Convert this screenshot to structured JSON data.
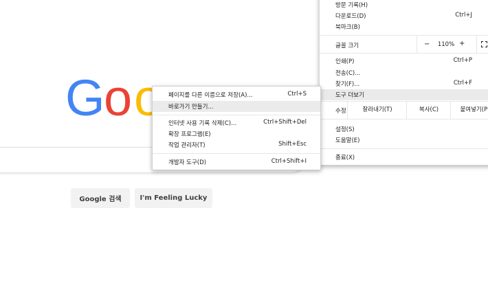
{
  "google": {
    "logo_letters": [
      {
        "ch": "G",
        "color": "#4285F4"
      },
      {
        "ch": "o",
        "color": "#EA4335"
      },
      {
        "ch": "o",
        "color": "#FBBC05"
      }
    ],
    "search_value": "",
    "search_button": "Google 검색",
    "lucky_button": "I'm Feeling Lucky"
  },
  "main_menu": {
    "history": {
      "label": "방문 기록(H)",
      "shortcut": ""
    },
    "downloads": {
      "label": "다운로드(D)",
      "shortcut": "Ctrl+J"
    },
    "bookmarks": {
      "label": "북마크(B)",
      "shortcut": ""
    },
    "zoom": {
      "label": "글꼴 크기",
      "minus": "−",
      "value": "110%",
      "plus": "+"
    },
    "print": {
      "label": "인쇄(P)",
      "shortcut": "Ctrl+P"
    },
    "cast": {
      "label": "전송(C)...",
      "shortcut": ""
    },
    "find": {
      "label": "찾기(F)...",
      "shortcut": "Ctrl+F"
    },
    "more_tools": {
      "label": "도구 더보기",
      "shortcut": ""
    },
    "edit": {
      "label": "수정",
      "cut": "잘라내기(T)",
      "copy": "복사(C)",
      "paste": "붙여넣기(P)"
    },
    "settings": {
      "label": "설정(S)"
    },
    "help": {
      "label": "도움말(E)"
    },
    "exit": {
      "label": "종료(X)"
    }
  },
  "sub_menu": {
    "save_page": {
      "label": "페이지를 다른 이름으로 저장(A)...",
      "shortcut": "Ctrl+S"
    },
    "create_shortcut": {
      "label": "바로가기 만들기...",
      "shortcut": ""
    },
    "clear_data": {
      "label": "인터넷 사용 기록 삭제(C)...",
      "shortcut": "Ctrl+Shift+Del"
    },
    "extensions": {
      "label": "확장 프로그램(E)",
      "shortcut": ""
    },
    "task_manager": {
      "label": "작업 관리자(T)",
      "shortcut": "Shift+Esc"
    },
    "dev_tools": {
      "label": "개발자 도구(D)",
      "shortcut": "Ctrl+Shift+I"
    }
  }
}
